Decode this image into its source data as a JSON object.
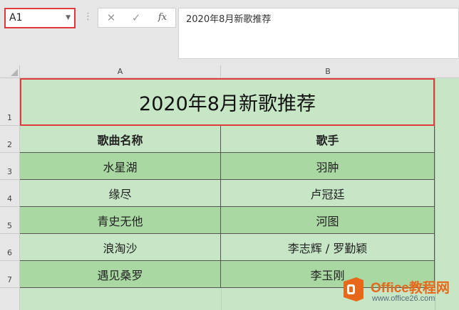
{
  "formula_bar": {
    "name_box": "A1",
    "cancel_icon": "✕",
    "enter_icon": "✓",
    "fx_label": "fx",
    "formula_text": "2020年8月新歌推荐"
  },
  "columns": [
    "A",
    "B"
  ],
  "rows": [
    "1",
    "2",
    "3",
    "4",
    "5",
    "6",
    "7"
  ],
  "sheet": {
    "title": "2020年8月新歌推荐",
    "header": {
      "song": "歌曲名称",
      "singer": "歌手"
    },
    "records": [
      {
        "song": "水星湖",
        "singer": "羽肿"
      },
      {
        "song": "缘尽",
        "singer": "卢冠廷"
      },
      {
        "song": "青史无他",
        "singer": "河图"
      },
      {
        "song": "浪淘沙",
        "singer": "李志辉 / 罗勤颖"
      },
      {
        "song": "遇见桑罗",
        "singer": "李玉刚"
      }
    ]
  },
  "watermark": {
    "brand": "Office教程网",
    "url": "www.office26.com"
  },
  "colors": {
    "cell_green": "#c6e6c6",
    "cell_green_dark": "#a9d8a3",
    "selection_red": "#e03b3b",
    "brand_orange": "#e8681a"
  }
}
